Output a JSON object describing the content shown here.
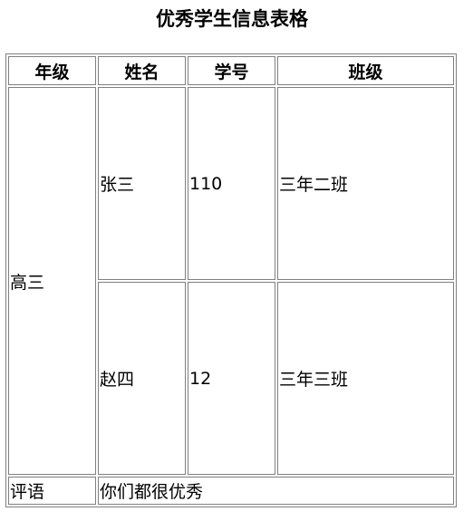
{
  "page": {
    "caption": "优秀学生信息表格"
  },
  "table": {
    "headers": [
      "年级",
      "姓名",
      "学号",
      "班级"
    ],
    "grade": "高三",
    "students": [
      {
        "name": "张三",
        "student_id": "110",
        "class": "三年二班"
      },
      {
        "name": "赵四",
        "student_id": "12",
        "class": "三年三班"
      }
    ],
    "comment_label": "评语",
    "comment_text": "你们都很优秀"
  }
}
